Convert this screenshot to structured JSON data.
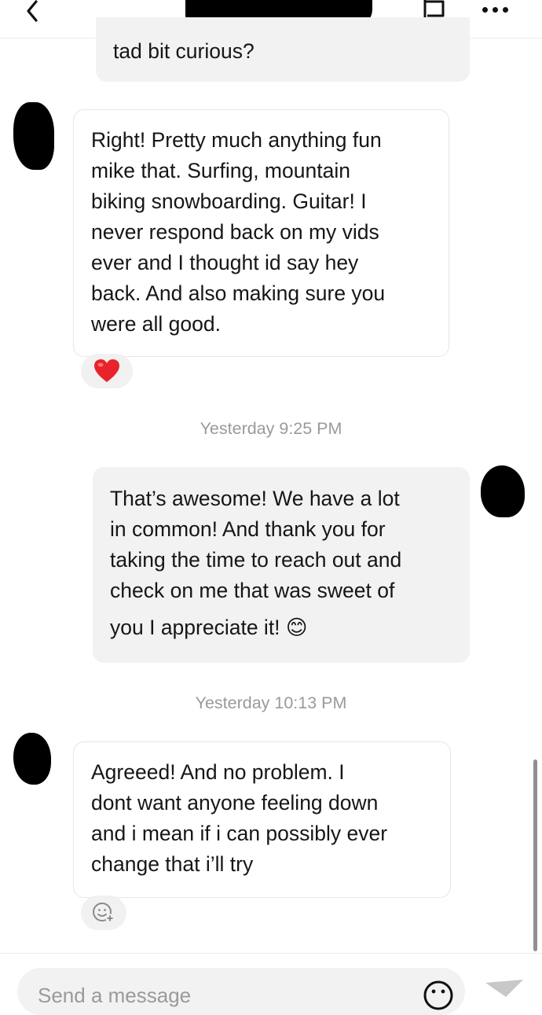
{
  "header": {
    "back_icon": "chevron-left-icon",
    "contact_name": "",
    "flag_icon": "flag-icon",
    "more_icon": "more-dots-icon"
  },
  "messages": [
    {
      "id": "m0",
      "direction": "out",
      "text": "tad bit curious?"
    },
    {
      "id": "m1",
      "direction": "in",
      "lines": [
        "Right! Pretty much anything fun",
        "mike that. Surfing, mountain",
        "biking snowboarding. Guitar! I",
        "never respond back on my vids",
        "ever and I thought id say hey",
        "back. And also making sure you",
        "were all good."
      ],
      "reaction": "❤️"
    },
    {
      "id": "ts1",
      "type": "timestamp",
      "text": "Yesterday 9:25 PM"
    },
    {
      "id": "m2",
      "direction": "out",
      "lines": [
        "That’s awesome! We have a lot",
        "in common! And thank you for",
        "taking the time to reach out and",
        "check on me that was sweet of",
        "you I appreciate it! 😊"
      ]
    },
    {
      "id": "ts2",
      "type": "timestamp",
      "text": "Yesterday 10:13 PM"
    },
    {
      "id": "m3",
      "direction": "in",
      "lines": [
        "Agreeed! And no problem. I",
        "dont want anyone feeling down",
        "and i mean if i can possibly ever",
        "change that i’ll try"
      ],
      "reaction_icon": "add-reaction-icon"
    }
  ],
  "composer": {
    "placeholder": "Send a message",
    "emoji_icon": "smiley-icon",
    "send_icon": "send-arrow-icon"
  },
  "colors": {
    "incoming_bubble": "#ffffff",
    "outgoing_bubble": "#f2f2f3",
    "timestamp": "#9a9a9a",
    "text": "#161616"
  }
}
